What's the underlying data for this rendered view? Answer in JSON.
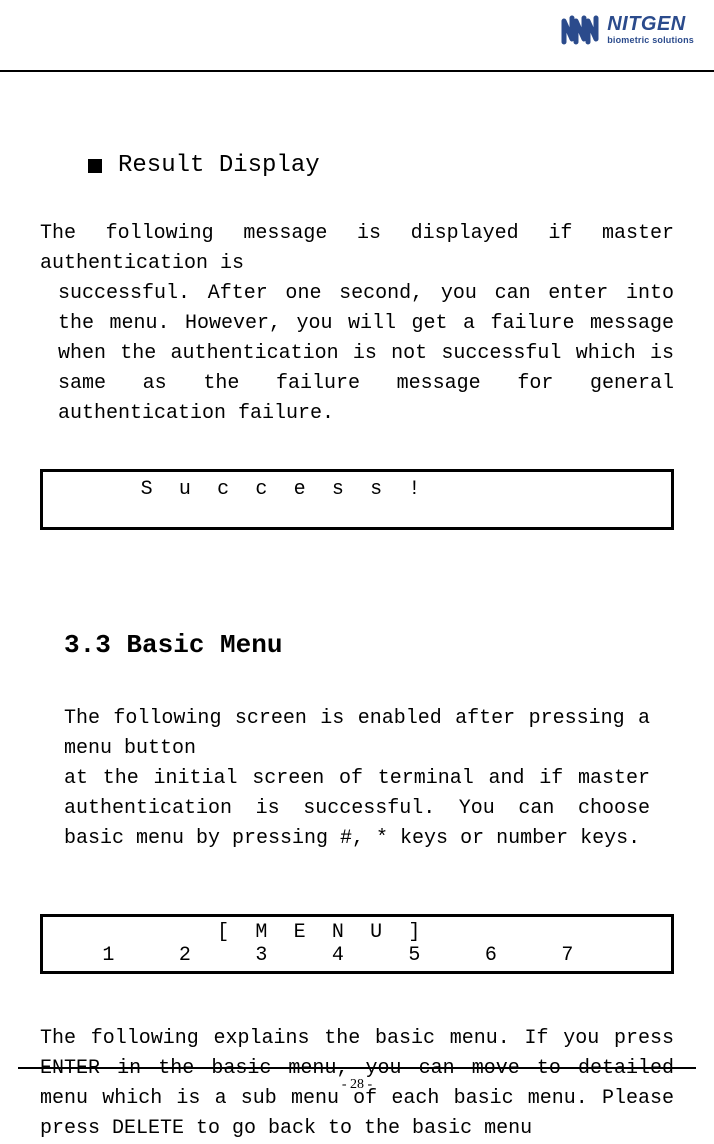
{
  "logo": {
    "brand": "NITGEN",
    "tagline": "biometric solutions"
  },
  "bullet_title": "Result Display",
  "para1_line1": "The following message is displayed if master authentication is",
  "para1_rest": "successful. After one second, you can enter into the menu. However, you will get a failure message when the authentication is not successful which is same as the failure message for general authentication failure.",
  "success_chars": [
    "",
    "",
    "S",
    "u",
    "c",
    "c",
    "e",
    "s",
    "s",
    "!",
    "",
    "",
    "",
    "",
    "",
    ""
  ],
  "section_heading": "3.3 Basic Menu",
  "para2_line1": "The following screen is enabled after pressing a menu button",
  "para2_rest": "at the initial screen of terminal and if master authentication is successful. You can choose basic menu by pressing #, * keys or number keys.",
  "menu_row1": [
    "",
    "",
    "",
    "",
    "[",
    "M",
    "E",
    "N",
    "U",
    "]",
    "",
    "",
    "",
    "",
    "",
    ""
  ],
  "menu_row2": [
    "",
    "1",
    "",
    "2",
    "",
    "3",
    "",
    "4",
    "",
    "5",
    "",
    "6",
    "",
    "7",
    "",
    ""
  ],
  "para3": "The following explains the basic menu. If you press ENTER in the basic menu, you can move to detailed menu which is a sub menu of each basic menu. Please press DELETE to go back to the basic menu",
  "page_number": "- 28 -"
}
